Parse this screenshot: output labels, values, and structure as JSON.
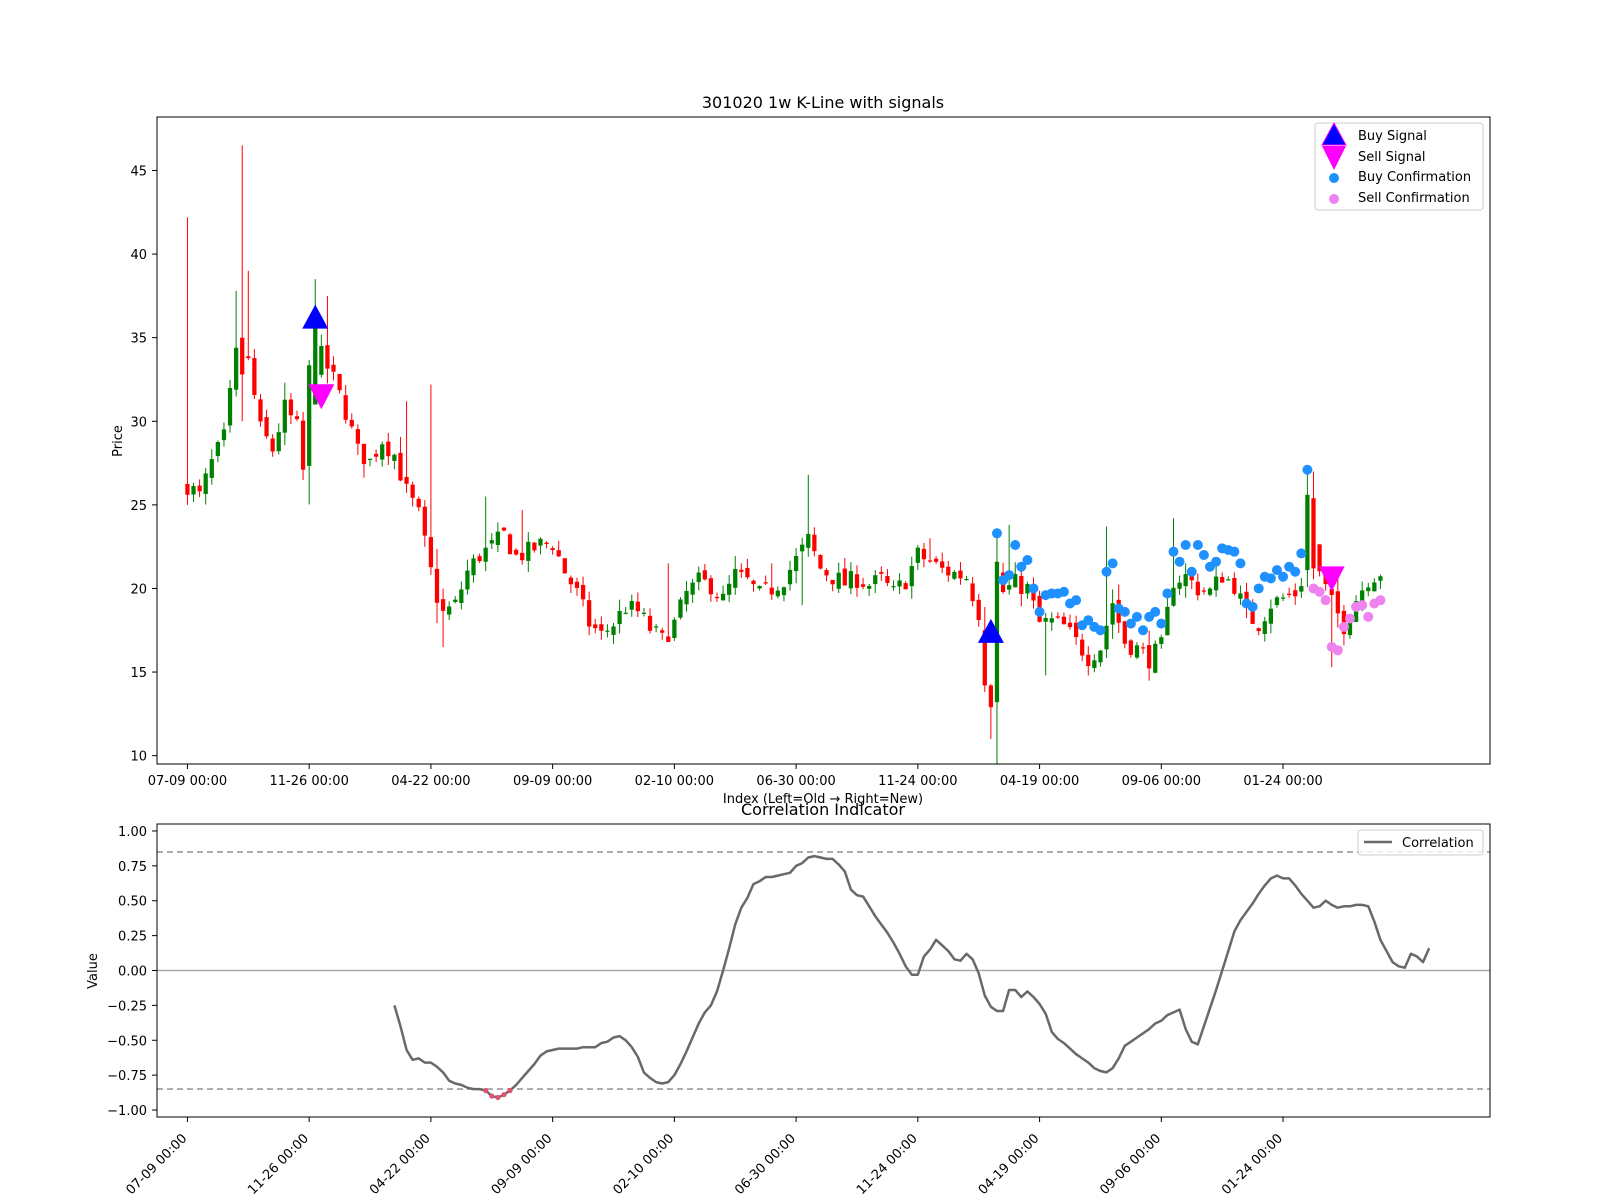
{
  "chart_data": [
    {
      "type": "candlestick",
      "title": "301020 1w K-Line with signals",
      "xlabel": "Index (Left=Old → Right=New)",
      "ylabel": "Price",
      "ylim": [
        9.5,
        48.2
      ],
      "yticks": [
        10,
        15,
        20,
        25,
        30,
        35,
        40,
        45
      ],
      "xlim": [
        -5,
        214
      ],
      "xticks": [
        {
          "i": 0,
          "label": "07-09 00:00"
        },
        {
          "i": 20,
          "label": "11-26 00:00"
        },
        {
          "i": 40,
          "label": "04-22 00:00"
        },
        {
          "i": 60,
          "label": "09-09 00:00"
        },
        {
          "i": 80,
          "label": "02-10 00:00"
        },
        {
          "i": 100,
          "label": "06-30 00:00"
        },
        {
          "i": 120,
          "label": "11-24 00:00"
        },
        {
          "i": 140,
          "label": "04-19 00:00"
        },
        {
          "i": 160,
          "label": "09-06 00:00"
        },
        {
          "i": 180,
          "label": "01-24 00:00"
        }
      ],
      "legend": {
        "position": "top-right",
        "items": [
          "Buy Signal",
          "Sell Signal",
          "Buy Confirmation",
          "Sell Confirmation"
        ]
      },
      "colors": {
        "up": "#008000",
        "down": "#ff0000",
        "buy_signal": "#0000ff",
        "sell_signal": "#ff00ff",
        "buy_confirmation": "#1e90ff",
        "sell_confirmation": "#ee82ee"
      },
      "buy_signals": [
        {
          "i": 21,
          "price": 36.2
        },
        {
          "i": 132,
          "price": 17.4
        }
      ],
      "sell_signals": [
        {
          "i": 22,
          "price": 31.5
        },
        {
          "i": 188,
          "price": 20.6
        }
      ],
      "buy_confirmations": [
        [
          133,
          23.3
        ],
        [
          134,
          20.5
        ],
        [
          135,
          20.8
        ],
        [
          136,
          22.6
        ],
        [
          137,
          21.3
        ],
        [
          138,
          21.7
        ],
        [
          139,
          20.0
        ],
        [
          140,
          18.6
        ],
        [
          141,
          19.6
        ],
        [
          142,
          19.7
        ],
        [
          143,
          19.7
        ],
        [
          144,
          19.8
        ],
        [
          145,
          19.1
        ],
        [
          146,
          19.3
        ],
        [
          147,
          17.8
        ],
        [
          148,
          18.1
        ],
        [
          149,
          17.7
        ],
        [
          150,
          17.5
        ],
        [
          151,
          21.0
        ],
        [
          152,
          21.5
        ],
        [
          153,
          18.8
        ],
        [
          154,
          18.6
        ],
        [
          155,
          17.9
        ],
        [
          156,
          18.3
        ],
        [
          157,
          17.5
        ],
        [
          158,
          18.3
        ],
        [
          159,
          18.6
        ],
        [
          160,
          17.9
        ],
        [
          161,
          19.7
        ],
        [
          162,
          22.2
        ],
        [
          163,
          21.6
        ],
        [
          164,
          22.6
        ],
        [
          165,
          21.0
        ],
        [
          166,
          22.6
        ],
        [
          167,
          22.0
        ],
        [
          168,
          21.3
        ],
        [
          169,
          21.6
        ],
        [
          170,
          22.4
        ],
        [
          171,
          22.3
        ],
        [
          172,
          22.2
        ],
        [
          173,
          21.5
        ],
        [
          174,
          19.1
        ],
        [
          175,
          18.9
        ],
        [
          176,
          20.0
        ],
        [
          177,
          20.7
        ],
        [
          178,
          20.6
        ],
        [
          179,
          21.1
        ],
        [
          180,
          20.7
        ],
        [
          181,
          21.3
        ],
        [
          182,
          21.0
        ],
        [
          183,
          22.1
        ],
        [
          184,
          27.1
        ]
      ],
      "sell_confirmations": [
        [
          185,
          20.0
        ],
        [
          186,
          19.8
        ],
        [
          187,
          19.3
        ],
        [
          188,
          16.5
        ],
        [
          189,
          16.3
        ],
        [
          190,
          17.7
        ],
        [
          191,
          18.2
        ],
        [
          192,
          18.9
        ],
        [
          193,
          19.0
        ],
        [
          194,
          18.3
        ],
        [
          195,
          19.1
        ],
        [
          196,
          19.3
        ]
      ],
      "candles": []
    },
    {
      "type": "line",
      "title": "Correlation Indicator",
      "xlabel": "",
      "ylabel": "Value",
      "ylim": [
        -1.05,
        1.05
      ],
      "yticks": [
        "1.00",
        "0.75",
        "0.50",
        "0.25",
        "0.00",
        "−0.25",
        "−0.50",
        "−0.75",
        "−1.00"
      ],
      "thresholds": [
        0.85,
        -0.85
      ],
      "zero_line": 0,
      "xtick_labels": [
        "07-09 00:00",
        "11-26 00:00",
        "04-22 00:00",
        "09-09 00:00",
        "02-10 00:00",
        "06-30 00:00",
        "11-24 00:00",
        "04-19 00:00",
        "09-06 00:00",
        "01-24 00:00"
      ],
      "legend": {
        "position": "top-right",
        "items": [
          "Correlation"
        ]
      },
      "series": [
        {
          "name": "Correlation",
          "color": "#696969",
          "highlight_color": "#e05070",
          "x_start": 34,
          "values": [
            -0.25,
            -0.4,
            -0.57,
            -0.64,
            -0.63,
            -0.66,
            -0.66,
            -0.69,
            -0.73,
            -0.79,
            -0.81,
            -0.82,
            -0.84,
            -0.85,
            -0.85,
            -0.86,
            -0.9,
            -0.91,
            -0.89,
            -0.86,
            -0.82,
            -0.77,
            -0.72,
            -0.67,
            -0.61,
            -0.58,
            -0.57,
            -0.56,
            -0.56,
            -0.56,
            -0.56,
            -0.55,
            -0.55,
            -0.55,
            -0.52,
            -0.51,
            -0.48,
            -0.47,
            -0.5,
            -0.55,
            -0.62,
            -0.73,
            -0.77,
            -0.8,
            -0.81,
            -0.8,
            -0.75,
            -0.67,
            -0.58,
            -0.48,
            -0.38,
            -0.3,
            -0.25,
            -0.15,
            0.0,
            0.16,
            0.33,
            0.45,
            0.52,
            0.62,
            0.64,
            0.67,
            0.67,
            0.68,
            0.69,
            0.7,
            0.75,
            0.77,
            0.81,
            0.82,
            0.81,
            0.8,
            0.8,
            0.76,
            0.71,
            0.58,
            0.54,
            0.53,
            0.46,
            0.39,
            0.33,
            0.27,
            0.2,
            0.12,
            0.03,
            -0.03,
            -0.03,
            0.1,
            0.15,
            0.22,
            0.18,
            0.14,
            0.08,
            0.07,
            0.12,
            0.08,
            -0.02,
            -0.18,
            -0.26,
            -0.29,
            -0.29,
            -0.14,
            -0.14,
            -0.19,
            -0.15,
            -0.19,
            -0.24,
            -0.31,
            -0.44,
            -0.49,
            -0.52,
            -0.56,
            -0.6,
            -0.63,
            -0.66,
            -0.7,
            -0.72,
            -0.73,
            -0.7,
            -0.63,
            -0.54,
            -0.51,
            -0.48,
            -0.45,
            -0.42,
            -0.38,
            -0.36,
            -0.32,
            -0.3,
            -0.28,
            -0.42,
            -0.51,
            -0.53,
            -0.4,
            -0.27,
            -0.14,
            0.0,
            0.14,
            0.28,
            0.36,
            0.42,
            0.48,
            0.55,
            0.61,
            0.66,
            0.68,
            0.66,
            0.66,
            0.61,
            0.55,
            0.5,
            0.45,
            0.46,
            0.5,
            0.47,
            0.45,
            0.46,
            0.46,
            0.47,
            0.47,
            0.46,
            0.35,
            0.22,
            0.14,
            0.06,
            0.03,
            0.02,
            0.12,
            0.1,
            0.06,
            0.16
          ]
        }
      ]
    }
  ]
}
